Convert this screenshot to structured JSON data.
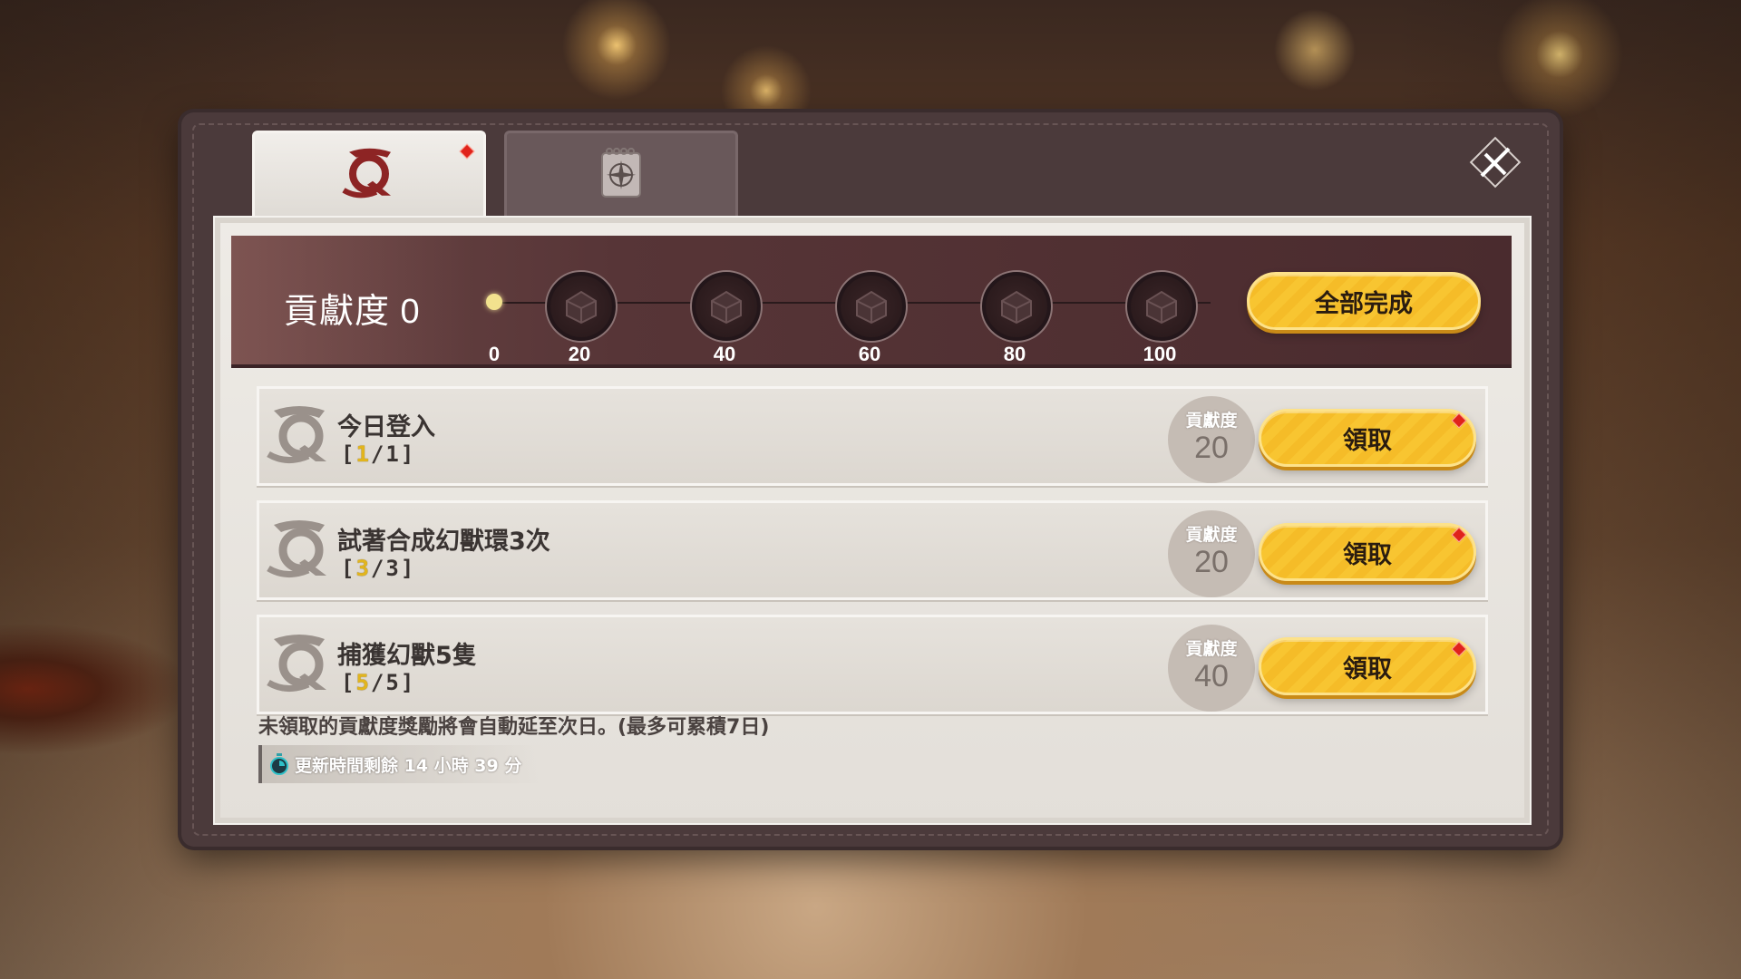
{
  "tabs": [
    {
      "icon": "quest-scroll-icon",
      "active": true
    },
    {
      "icon": "compass-notebook-icon",
      "active": false
    }
  ],
  "contribution": {
    "title": "貢獻度 0",
    "current": 0,
    "max": 100,
    "milestones": [
      "0",
      "20",
      "40",
      "60",
      "80",
      "100"
    ],
    "complete_all_label": "全部完成"
  },
  "quests": [
    {
      "title": "今日登入",
      "current": "1",
      "total": "1",
      "reward_label": "貢獻度",
      "reward_value": "20",
      "button": "領取"
    },
    {
      "title": "試著合成幻獸環3次",
      "current": "3",
      "total": "3",
      "reward_label": "貢獻度",
      "reward_value": "20",
      "button": "領取"
    },
    {
      "title": "捕獲幻獸5隻",
      "current": "5",
      "total": "5",
      "reward_label": "貢獻度",
      "reward_value": "40",
      "button": "領取"
    }
  ],
  "footer": {
    "note": "未領取的貢獻度獎勵將會自動延至次日。(最多可累積7日)",
    "timer": "更新時間剩餘 14 小時 39 分"
  },
  "colors": {
    "accent_gold": "#f8c531",
    "band": "#573537",
    "alert_red": "#e0231b"
  }
}
